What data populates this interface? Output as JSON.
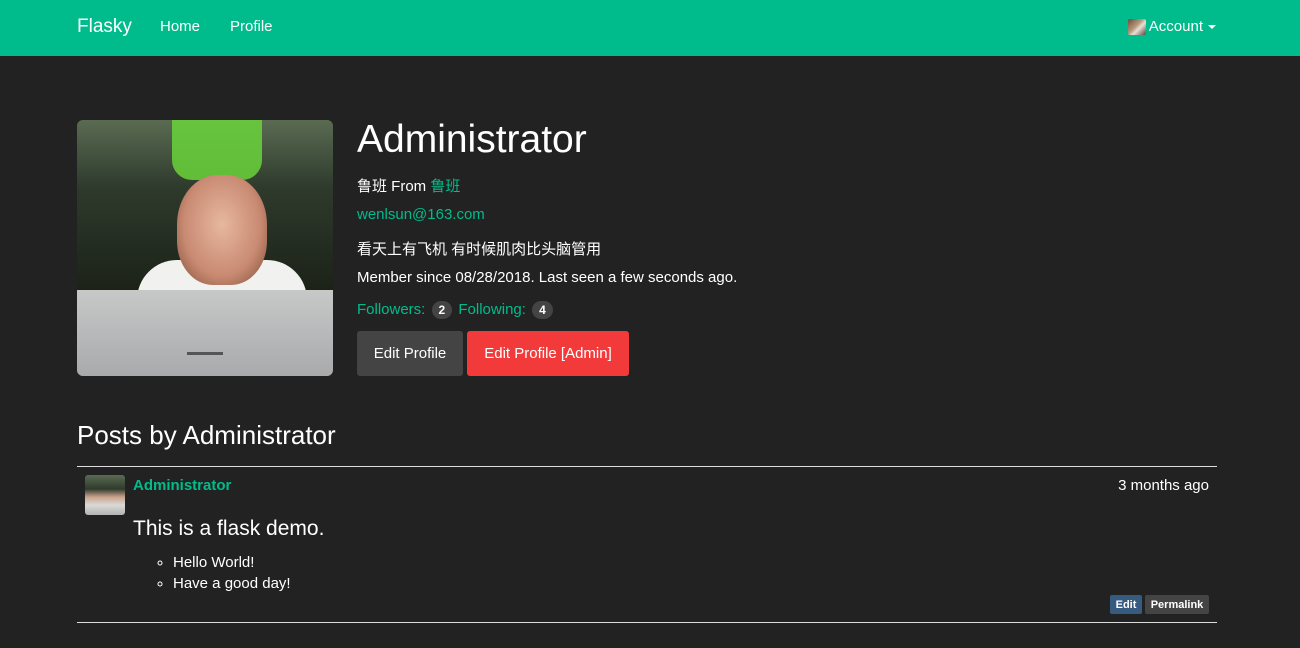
{
  "navbar": {
    "brand": "Flasky",
    "links": [
      "Home",
      "Profile"
    ],
    "account_label": "Account"
  },
  "profile": {
    "name": "Administrator",
    "location_prefix": "鲁班 From ",
    "location": "鲁班",
    "email": "wenlsun@163.com",
    "about": "看天上有飞机 有时候肌肉比头脑管用",
    "member_since": "Member since 08/28/2018. Last seen a few seconds ago.",
    "followers_label": "Followers:",
    "followers_count": "2",
    "following_label": "Following:",
    "following_count": "4",
    "edit_button": "Edit Profile",
    "admin_button": "Edit Profile [Admin]"
  },
  "posts": {
    "heading": "Posts by Administrator",
    "items": [
      {
        "author": "Administrator",
        "date": "3 months ago",
        "title": "This is a flask demo.",
        "bullets": [
          "Hello World!",
          "Have a good day!"
        ],
        "edit_label": "Edit",
        "permalink_label": "Permalink"
      }
    ]
  },
  "colors": {
    "accent": "#00bc8c",
    "background": "#222222",
    "danger": "#f23a3a",
    "secondary": "#444444",
    "primary": "#375a7f"
  }
}
